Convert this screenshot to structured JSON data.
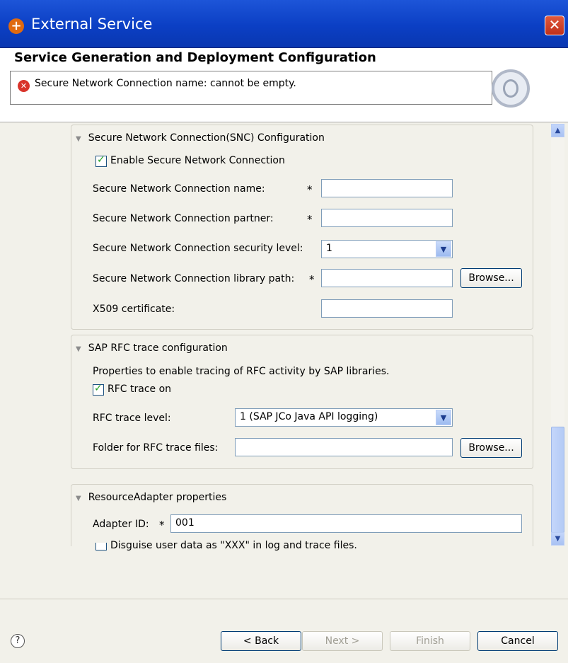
{
  "window": {
    "title": "External Service",
    "close_glyph": "✕",
    "app_glyph": "+"
  },
  "header": {
    "title": "Service Generation and Deployment Configuration",
    "message": "Secure Network Connection name: cannot be empty.",
    "error_glyph": "✕"
  },
  "snc": {
    "heading": "Secure Network Connection(SNC) Configuration",
    "enable_label": "Enable Secure Network Connection",
    "enable_checked": true,
    "name_label": "Secure Network Connection name:",
    "name_value": "",
    "partner_label": "Secure Network Connection partner:",
    "partner_value": "",
    "level_label": "Secure Network Connection security level:",
    "level_value": "1",
    "library_label": "Secure Network Connection library path:",
    "library_value": "",
    "browse_label": "Browse...",
    "cert_label": "X509 certificate:",
    "cert_value": "",
    "required_marker": "*"
  },
  "rfc": {
    "heading": "SAP RFC trace configuration",
    "description": "Properties to enable tracing of RFC activity by SAP libraries.",
    "trace_on_label": "RFC trace on",
    "trace_on_checked": true,
    "level_label": "RFC trace level:",
    "level_value": "1 (SAP JCo Java API logging)",
    "folder_label": "Folder for RFC trace files:",
    "folder_value": "",
    "browse_label": "Browse..."
  },
  "adapter": {
    "heading": "ResourceAdapter properties",
    "id_label": "Adapter ID:",
    "required_marker": "*",
    "id_value": "001",
    "disguise_label": "Disguise user data as \"XXX\" in log and trace files.",
    "disguise_checked": false
  },
  "footer": {
    "help_glyph": "?",
    "back_label": "< Back",
    "next_label": "Next >",
    "finish_label": "Finish",
    "cancel_label": "Cancel"
  },
  "icons": {
    "collapse": "▼",
    "dropdown": "▼",
    "check": "✓",
    "scroll_up": "▲",
    "scroll_down": "▼"
  }
}
